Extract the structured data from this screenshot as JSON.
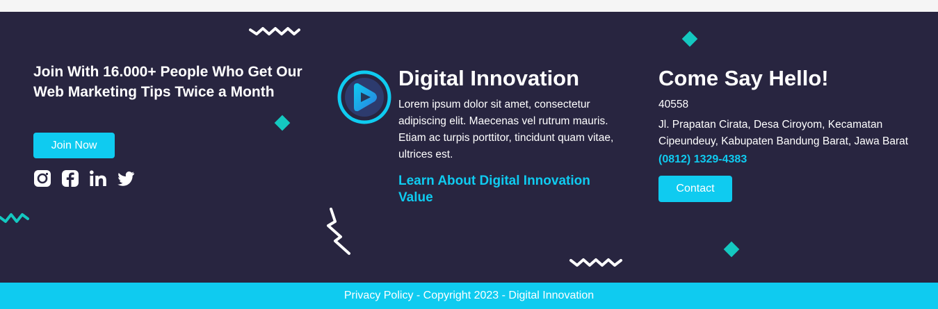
{
  "colors": {
    "background": "#282540",
    "accent": "#0fcbf0",
    "decoration": "#14c8c0",
    "text": "#ffffff"
  },
  "newsletter": {
    "title": "Join With 16.000+ People Who Get Our Web Marketing Tips Twice a Month",
    "join_label": "Join Now",
    "socials": [
      "instagram-icon",
      "facebook-icon",
      "linkedin-icon",
      "twitter-icon"
    ]
  },
  "brand": {
    "logo_icon": "play-icon",
    "title": "Digital Innovation",
    "description": "Lorem ipsum dolor sit amet, consectetur adipiscing elit. Maecenas vel rutrum mauris. Etiam ac turpis porttitor, tincidunt quam vitae, ultrices est.",
    "learn_link": "Learn About Digital Innovation Value"
  },
  "contact": {
    "title": "Come Say Hello!",
    "postal_code": "40558",
    "address": "Jl. Prapatan Cirata, Desa Ciroyom, Kecamatan Cipeundeuy, Kabupaten Bandung Barat, Jawa Barat",
    "phone": "(0812) 1329-4383",
    "button_label": "Contact"
  },
  "footer_bar": {
    "text": "Privacy Policy - Copyright 2023 - Digital Innovation"
  }
}
